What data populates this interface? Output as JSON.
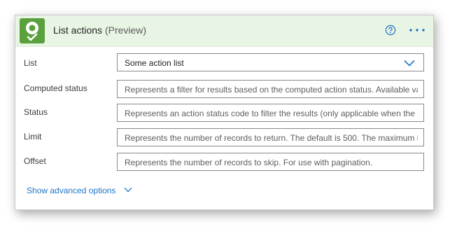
{
  "header": {
    "title": "List actions",
    "title_suffix": "(Preview)",
    "logo_icon": "robot-checkmark-icon",
    "help_icon": "help-circle-icon",
    "more_icon": "more-ellipsis-icon",
    "background_color": "#e9f5e4",
    "logo_color": "#5aa13d"
  },
  "fields": [
    {
      "label": "List",
      "value": "Some action list",
      "placeholder": "",
      "type": "dropdown"
    },
    {
      "label": "Computed status",
      "value": "",
      "placeholder": "Represents a filter for results based on the computed action status. Available va",
      "type": "text"
    },
    {
      "label": "Status",
      "value": "",
      "placeholder": "Represents an action status code to filter the results (only applicable when the s",
      "type": "text"
    },
    {
      "label": "Limit",
      "value": "",
      "placeholder": "Represents the number of records to return. The default is 500. The maximum is",
      "type": "text"
    },
    {
      "label": "Offset",
      "value": "",
      "placeholder": "Represents the number of records to skip. For use with pagination.",
      "type": "text"
    }
  ],
  "advanced": {
    "label": "Show advanced options",
    "icon": "chevron-down-icon",
    "color": "#1d74c8"
  }
}
